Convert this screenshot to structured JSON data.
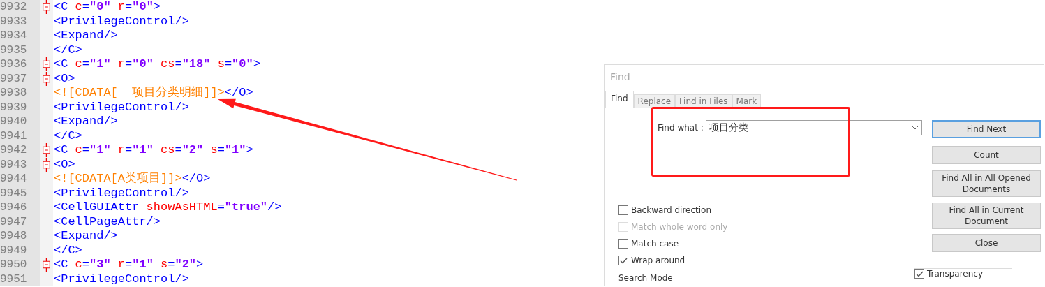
{
  "editor": {
    "lines": [
      {
        "number": "9932",
        "fold": true,
        "tokens": [
          {
            "kind": "tag",
            "text": "<C"
          },
          {
            "kind": "attr",
            "text": " c"
          },
          {
            "kind": "tag",
            "text": "="
          },
          {
            "kind": "value",
            "text": "\"0\""
          },
          {
            "kind": "attr",
            "text": " r"
          },
          {
            "kind": "tag",
            "text": "="
          },
          {
            "kind": "value",
            "text": "\"0\""
          },
          {
            "kind": "tag",
            "text": ">"
          }
        ]
      },
      {
        "number": "9933",
        "fold": false,
        "tokens": [
          {
            "kind": "tag",
            "text": "<PrivilegeControl/>"
          }
        ]
      },
      {
        "number": "9934",
        "fold": false,
        "tokens": [
          {
            "kind": "tag",
            "text": "<Expand/>"
          }
        ]
      },
      {
        "number": "9935",
        "fold": false,
        "tokens": [
          {
            "kind": "tag",
            "text": "</C>"
          }
        ]
      },
      {
        "number": "9936",
        "fold": true,
        "tokens": [
          {
            "kind": "tag",
            "text": "<C"
          },
          {
            "kind": "attr",
            "text": " c"
          },
          {
            "kind": "tag",
            "text": "="
          },
          {
            "kind": "value",
            "text": "\"1\""
          },
          {
            "kind": "attr",
            "text": " r"
          },
          {
            "kind": "tag",
            "text": "="
          },
          {
            "kind": "value",
            "text": "\"0\""
          },
          {
            "kind": "attr",
            "text": " cs"
          },
          {
            "kind": "tag",
            "text": "="
          },
          {
            "kind": "value",
            "text": "\"18\""
          },
          {
            "kind": "attr",
            "text": " s"
          },
          {
            "kind": "tag",
            "text": "="
          },
          {
            "kind": "value",
            "text": "\"0\""
          },
          {
            "kind": "tag",
            "text": ">"
          }
        ]
      },
      {
        "number": "9937",
        "fold": true,
        "tokens": [
          {
            "kind": "tag",
            "text": "<O>"
          }
        ]
      },
      {
        "number": "9938",
        "fold": false,
        "tokens": [
          {
            "kind": "cdata",
            "text": "<![CDATA[  项目分类明细]]>"
          },
          {
            "kind": "tag",
            "text": "</O>"
          }
        ]
      },
      {
        "number": "9939",
        "fold": false,
        "tokens": [
          {
            "kind": "tag",
            "text": "<PrivilegeControl/>"
          }
        ]
      },
      {
        "number": "9940",
        "fold": false,
        "tokens": [
          {
            "kind": "tag",
            "text": "<Expand/>"
          }
        ]
      },
      {
        "number": "9941",
        "fold": false,
        "tokens": [
          {
            "kind": "tag",
            "text": "</C>"
          }
        ]
      },
      {
        "number": "9942",
        "fold": true,
        "tokens": [
          {
            "kind": "tag",
            "text": "<C"
          },
          {
            "kind": "attr",
            "text": " c"
          },
          {
            "kind": "tag",
            "text": "="
          },
          {
            "kind": "value",
            "text": "\"1\""
          },
          {
            "kind": "attr",
            "text": " r"
          },
          {
            "kind": "tag",
            "text": "="
          },
          {
            "kind": "value",
            "text": "\"1\""
          },
          {
            "kind": "attr",
            "text": " cs"
          },
          {
            "kind": "tag",
            "text": "="
          },
          {
            "kind": "value",
            "text": "\"2\""
          },
          {
            "kind": "attr",
            "text": " s"
          },
          {
            "kind": "tag",
            "text": "="
          },
          {
            "kind": "value",
            "text": "\"1\""
          },
          {
            "kind": "tag",
            "text": ">"
          }
        ]
      },
      {
        "number": "9943",
        "fold": true,
        "tokens": [
          {
            "kind": "tag",
            "text": "<O>"
          }
        ]
      },
      {
        "number": "9944",
        "fold": false,
        "tokens": [
          {
            "kind": "cdata",
            "text": "<![CDATA[A类项目]]>"
          },
          {
            "kind": "tag",
            "text": "</O>"
          }
        ]
      },
      {
        "number": "9945",
        "fold": false,
        "tokens": [
          {
            "kind": "tag",
            "text": "<PrivilegeControl/>"
          }
        ]
      },
      {
        "number": "9946",
        "fold": false,
        "tokens": [
          {
            "kind": "tag",
            "text": "<CellGUIAttr"
          },
          {
            "kind": "attr",
            "text": " showAsHTML"
          },
          {
            "kind": "tag",
            "text": "="
          },
          {
            "kind": "value",
            "text": "\"true\""
          },
          {
            "kind": "tag",
            "text": "/>"
          }
        ]
      },
      {
        "number": "9947",
        "fold": false,
        "tokens": [
          {
            "kind": "tag",
            "text": "<CellPageAttr/>"
          }
        ]
      },
      {
        "number": "9948",
        "fold": false,
        "tokens": [
          {
            "kind": "tag",
            "text": "<Expand/>"
          }
        ]
      },
      {
        "number": "9949",
        "fold": false,
        "tokens": [
          {
            "kind": "tag",
            "text": "</C>"
          }
        ]
      },
      {
        "number": "9950",
        "fold": true,
        "tokens": [
          {
            "kind": "tag",
            "text": "<C"
          },
          {
            "kind": "attr",
            "text": " c"
          },
          {
            "kind": "tag",
            "text": "="
          },
          {
            "kind": "value",
            "text": "\"3\""
          },
          {
            "kind": "attr",
            "text": " r"
          },
          {
            "kind": "tag",
            "text": "="
          },
          {
            "kind": "value",
            "text": "\"1\""
          },
          {
            "kind": "attr",
            "text": " s"
          },
          {
            "kind": "tag",
            "text": "="
          },
          {
            "kind": "value",
            "text": "\"2\""
          },
          {
            "kind": "tag",
            "text": ">"
          }
        ]
      },
      {
        "number": "9951",
        "fold": false,
        "tokens": [
          {
            "kind": "tag",
            "text": "<PrivilegeControl/>"
          }
        ]
      }
    ]
  },
  "find_dialog": {
    "title": "Find",
    "tabs": [
      {
        "label": "Find",
        "selected": true
      },
      {
        "label": "Replace",
        "selected": false
      },
      {
        "label": "Find in Files",
        "selected": false
      },
      {
        "label": "Mark",
        "selected": false
      }
    ],
    "find_what": {
      "label": "Find what :",
      "value": "项目分类"
    },
    "buttons": [
      {
        "label": "Find Next",
        "focused": true
      },
      {
        "label": "Count",
        "focused": false
      },
      {
        "label": "Find All in All Opened Documents",
        "focused": false
      },
      {
        "label": "Find All in Current Document",
        "focused": false
      },
      {
        "label": "Close",
        "focused": false
      }
    ],
    "options": [
      {
        "label": "Backward direction",
        "checked": false,
        "disabled": false
      },
      {
        "label": "Match whole word only",
        "checked": false,
        "disabled": true
      },
      {
        "label": "Match case",
        "checked": false,
        "disabled": false
      },
      {
        "label": "Wrap around",
        "checked": true,
        "disabled": false
      }
    ],
    "search_mode": {
      "label": "Search Mode"
    },
    "transparency": {
      "label": "Transparency",
      "checked": true
    }
  }
}
